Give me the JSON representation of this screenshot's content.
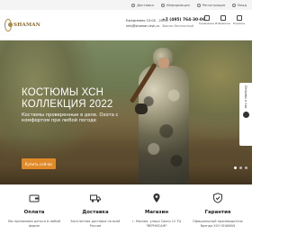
{
  "topbar": {
    "items": [
      {
        "label": "Доставка",
        "icon": "truck-icon"
      },
      {
        "label": "Информация",
        "icon": "info-icon"
      },
      {
        "label": "Регистрация",
        "icon": "user-icon"
      },
      {
        "label": "Вход",
        "icon": "login-icon"
      }
    ]
  },
  "header": {
    "logo_text": "SHAMAN",
    "hours_line1": "Ежедневно 10:00 - 20:00",
    "hours_line2": "info@shaman-hsh.ru",
    "phone": "+7 (495) 764-30-06",
    "phone_sub": "Звонок бесплатный",
    "icons": [
      {
        "label": "Сравнение",
        "icon": "compare-icon"
      },
      {
        "label": "Избранное",
        "icon": "heart-icon"
      },
      {
        "label": "Корзина",
        "icon": "cart-icon"
      }
    ]
  },
  "hero": {
    "title_line1": "КОСТЮМЫ ХСН",
    "title_line2": "КОЛЛЕКЦИЯ 2022",
    "subtitle": "Костюмы проверенные в деле. Охота с комфортом при любой погоде",
    "button_label": "Купить сейчас",
    "side_tab_label": "Отзывы о нас",
    "slides_total": 3,
    "slide_active": 1
  },
  "features": [
    {
      "icon": "wallet-icon",
      "title": "Оплата",
      "text": "Мы принимаем деньги в любой форме"
    },
    {
      "icon": "truck-icon",
      "title": "Доставка",
      "text": "Бесплатная доставка по всей России"
    },
    {
      "icon": "shop-icon",
      "title": "Магазин",
      "text": "г. Москва, улица Сакко 12 ТЦ \"ВЕРНИСАЖ\""
    },
    {
      "icon": "shield-icon",
      "title": "Гарантия",
      "text": "Официальный производитель бренда ХСН SHAMAN"
    }
  ]
}
